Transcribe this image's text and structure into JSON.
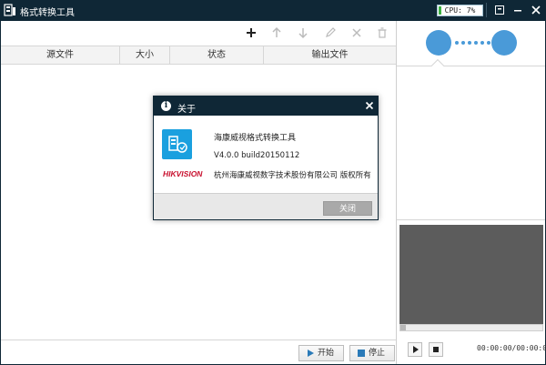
{
  "app": {
    "title": "格式转换工具",
    "cpu": "CPU: 7%",
    "cpu_percent": 7
  },
  "titlebar": {
    "buttons": [
      "menu-icon",
      "minimize-icon",
      "close-icon"
    ]
  },
  "toolbar": {
    "tools": [
      "add-icon",
      "move-up-icon",
      "move-down-icon",
      "edit-icon",
      "remove-icon",
      "delete-icon"
    ]
  },
  "table": {
    "columns": [
      "源文件",
      "大小",
      "状态",
      "输出文件"
    ],
    "rows": []
  },
  "bottom": {
    "start_label": "开始",
    "stop_label": "停止"
  },
  "preview": {
    "time": "00:00:00/00:00:00",
    "progress_percent": 0
  },
  "dialog": {
    "title": "关于",
    "product": "海康威视格式转换工具",
    "version": "V4.0.0 build20150112",
    "brand": "HIKVISION",
    "copyright": "杭州海康威视数字技术股份有限公司  版权所有",
    "close_label": "关闭"
  },
  "colors": {
    "titlebar": "#0f2736",
    "accent": "#4a9ad8",
    "logo": "#1aa0df",
    "brand": "#c8102e",
    "video": "#5c5c5c"
  }
}
